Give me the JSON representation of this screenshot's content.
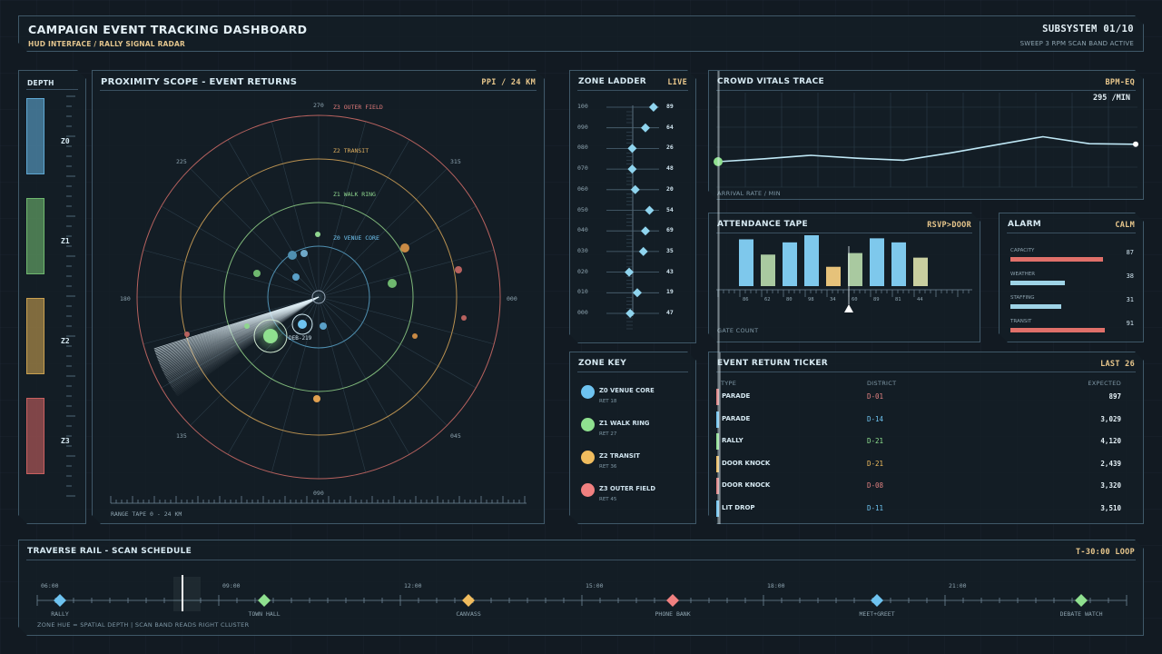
{
  "header": {
    "title": "CAMPAIGN EVENT TRACKING DASHBOARD",
    "subtitle": "HUD INTERFACE / RALLY SIGNAL RADAR",
    "subsystem": "SUBSYSTEM 01/10",
    "status": "SWEEP 3 RPM   SCAN BAND ACTIVE"
  },
  "depth": {
    "title": "DEPTH",
    "zones": [
      {
        "label": "Z0",
        "color": "#5fa8d3"
      },
      {
        "label": "Z1",
        "color": "#6fb86f"
      },
      {
        "label": "Z2",
        "color": "#c9a050"
      },
      {
        "label": "Z3",
        "color": "#c96060"
      }
    ]
  },
  "radar": {
    "title": "PROXIMITY SCOPE - EVENT RETURNS",
    "tag": "PPI / 24 KM",
    "rings": [
      {
        "label": "Z0 VENUE CORE",
        "color": "#5fa8d3"
      },
      {
        "label": "Z1 WALK RING",
        "color": "#8fd68f"
      },
      {
        "label": "Z2 TRANSIT",
        "color": "#e0b060"
      },
      {
        "label": "Z3 OUTER FIELD",
        "color": "#e07a7a"
      }
    ],
    "bearings": [
      "270",
      "315",
      "000",
      "045",
      "090",
      "135",
      "180",
      "225"
    ],
    "target_label": "DEB-219",
    "range_tape": "RANGE TAPE  0 - 24 KM"
  },
  "ladder": {
    "title": "ZONE LADDER",
    "tag": "LIVE",
    "rows": [
      {
        "left": "100",
        "right": "89",
        "level": 0.82
      },
      {
        "left": "090",
        "right": "64",
        "level": 0.66
      },
      {
        "left": "080",
        "right": "26",
        "level": 0.4
      },
      {
        "left": "070",
        "right": "48",
        "level": 0.4
      },
      {
        "left": "060",
        "right": "20",
        "level": 0.46
      },
      {
        "left": "050",
        "right": "54",
        "level": 0.74
      },
      {
        "left": "040",
        "right": "69",
        "level": 0.66
      },
      {
        "left": "030",
        "right": "35",
        "level": 0.62
      },
      {
        "left": "020",
        "right": "43",
        "level": 0.34
      },
      {
        "left": "010",
        "right": "19",
        "level": 0.5
      },
      {
        "left": "000",
        "right": "47",
        "level": 0.36
      }
    ]
  },
  "zone_key": {
    "title": "ZONE KEY",
    "items": [
      {
        "name": "Z0 VENUE CORE",
        "sub": "RET 18",
        "color": "#6ec3f0"
      },
      {
        "name": "Z1 WALK RING",
        "sub": "RET 27",
        "color": "#8fe08f"
      },
      {
        "name": "Z2 TRANSIT",
        "sub": "RET 36",
        "color": "#f0bc5e"
      },
      {
        "name": "Z3 OUTER FIELD",
        "sub": "RET 45",
        "color": "#f08080"
      }
    ]
  },
  "vitals": {
    "title": "CROWD VITALS TRACE",
    "tag": "BPM-EQ",
    "rate": "295 /MIN",
    "footer": "ARRIVAL RATE / MIN",
    "trace": [
      0.0,
      0.1,
      0.22,
      0.12,
      0.05,
      0.3,
      0.58,
      0.86,
      0.62,
      0.6
    ]
  },
  "attendance": {
    "title": "ATTENDANCE TAPE",
    "tag": "RSVP>DOOR",
    "footer": "GATE COUNT",
    "bars": [
      {
        "value": 0.92,
        "color": "#7ec8ec",
        "tick": "86"
      },
      {
        "value": 0.62,
        "color": "#a9c9a0",
        "tick": "62"
      },
      {
        "value": 0.86,
        "color": "#7ec8ec",
        "tick": "80"
      },
      {
        "value": 1.0,
        "color": "#7ec8ec",
        "tick": "98"
      },
      {
        "value": 0.38,
        "color": "#e6c27a",
        "tick": "34"
      },
      {
        "value": 0.65,
        "color": "#a9c9a0",
        "tick": "60"
      },
      {
        "value": 0.94,
        "color": "#7ec8ec",
        "tick": "89"
      },
      {
        "value": 0.86,
        "color": "#7ec8ec",
        "tick": "81"
      },
      {
        "value": 0.56,
        "color": "#c9cfa0",
        "tick": "44"
      }
    ]
  },
  "alarm": {
    "title": "ALARM",
    "tag": "CALM",
    "rows": [
      {
        "label": "CAPACITY",
        "value": "87",
        "fill": 0.94,
        "color": "#e0706a"
      },
      {
        "label": "WEATHER",
        "value": "38",
        "fill": 0.56,
        "color": "#9ed3e6"
      },
      {
        "label": "STAFFING",
        "value": "31",
        "fill": 0.52,
        "color": "#9ed3e6"
      },
      {
        "label": "TRANSIT",
        "value": "91",
        "fill": 0.96,
        "color": "#e0706a"
      }
    ]
  },
  "ticker": {
    "title": "EVENT RETURN TICKER",
    "tag": "LAST 26",
    "columns": [
      "TYPE",
      "DISTRICT",
      "EXPECTED"
    ],
    "rows": [
      {
        "type": "PARADE",
        "district": "D-01",
        "expected": "897",
        "color": "#e08080",
        "dcolor": "#e08080"
      },
      {
        "type": "PARADE",
        "district": "D-14",
        "expected": "3,029",
        "color": "#6ec3f0",
        "dcolor": "#6ec3f0"
      },
      {
        "type": "RALLY",
        "district": "D-21",
        "expected": "4,120",
        "color": "#8fe08f",
        "dcolor": "#8fe08f"
      },
      {
        "type": "DOOR KNOCK",
        "district": "D-21",
        "expected": "2,439",
        "color": "#f0bc5e",
        "dcolor": "#f0bc5e"
      },
      {
        "type": "DOOR KNOCK",
        "district": "D-08",
        "expected": "3,320",
        "color": "#e08080",
        "dcolor": "#e08080"
      },
      {
        "type": "LIT DROP",
        "district": "D-11",
        "expected": "3,510",
        "color": "#6ec3f0",
        "dcolor": "#6ec3f0"
      }
    ]
  },
  "rail": {
    "title": "TRAVERSE RAIL - SCAN SCHEDULE",
    "tag": "T-30:00 LOOP",
    "times": [
      "06:00",
      "09:00",
      "12:00",
      "15:00",
      "18:00",
      "21:00"
    ],
    "events": [
      {
        "label": "RALLY",
        "color": "#6ec3f0"
      },
      {
        "label": "TOWN HALL",
        "color": "#8fe08f"
      },
      {
        "label": "CANVASS",
        "color": "#f0bc5e"
      },
      {
        "label": "PHONE BANK",
        "color": "#f08080"
      },
      {
        "label": "MEET+GREET",
        "color": "#6ec3f0"
      },
      {
        "label": "DEBATE WATCH",
        "color": "#8fe08f"
      }
    ],
    "footer": "ZONE HUE = SPATIAL DEPTH  |  SCAN BAND READS RIGHT CLUSTER"
  }
}
